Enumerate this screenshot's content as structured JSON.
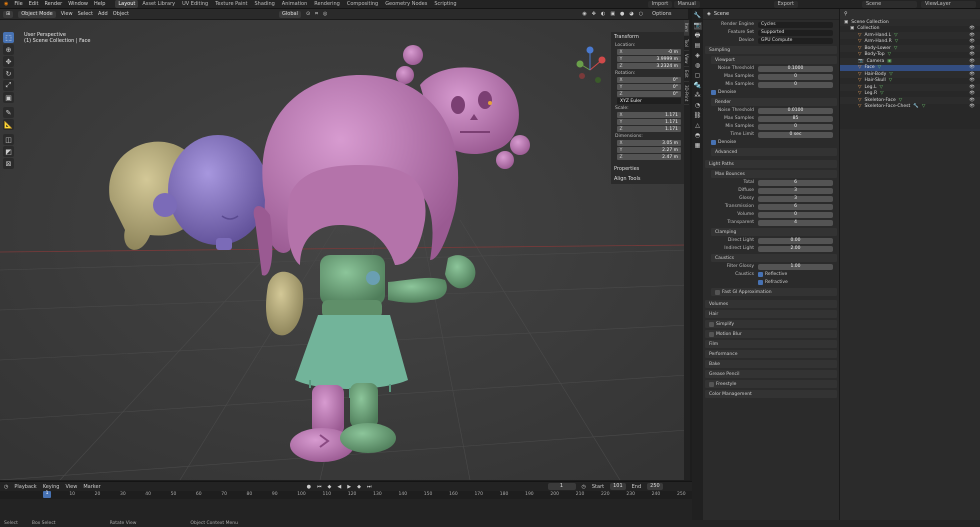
{
  "menu": [
    "File",
    "Edit",
    "Render",
    "Window",
    "Help"
  ],
  "workspaces": [
    "Layout",
    "Asset Library",
    "UV Editing",
    "Texture Paint",
    "Shading",
    "Animation",
    "Rendering",
    "Compositing",
    "Geometry Nodes",
    "Scripting"
  ],
  "top_right": {
    "export": "Export",
    "import": "Import",
    "manual": "Manual",
    "scene": "Scene",
    "view_layer": "ViewLayer"
  },
  "viewport_header": {
    "mode": "Object Mode",
    "view": "View",
    "select": "Select",
    "add": "Add",
    "object": "Object",
    "orientation": "Global",
    "options": "Options"
  },
  "viewport_info": {
    "line1": "User Perspective",
    "line2": "(1) Scene Collection | Face"
  },
  "transform": {
    "title": "Transform",
    "location_label": "Location:",
    "location": [
      "-0 m",
      "3.9999 m",
      "3.2324 m"
    ],
    "rotation_label": "Rotation:",
    "rotation": [
      "0°",
      "0°",
      "0°"
    ],
    "rotation_mode": "XYZ Euler",
    "scale_label": "Scale:",
    "scale": [
      "1.171",
      "1.171",
      "1.171"
    ],
    "dimensions_label": "Dimensions:",
    "dimensions": [
      "3.05 m",
      "2.27 m",
      "2.47 m"
    ],
    "axes": [
      "X",
      "Y",
      "Z"
    ],
    "properties": "Properties",
    "align_tools": "Align Tools"
  },
  "sidebar_tabs": [
    "Item",
    "Tool",
    "View",
    "Edit",
    "3D-Print"
  ],
  "props": {
    "scene": "Scene",
    "render_engine_label": "Render Engine",
    "render_engine": "Cycles",
    "feature_set_label": "Feature Set",
    "feature_set": "Supported",
    "device_label": "Device",
    "device": "GPU Compute",
    "sampling": "Sampling",
    "viewport": "Viewport",
    "vp_noise_label": "Noise Threshold",
    "vp_noise": "0.1000",
    "vp_max_label": "Max Samples",
    "vp_max": "0",
    "vp_min_label": "Min Samples",
    "vp_min": "0",
    "denoise": "Denoise",
    "render": "Render",
    "r_noise_label": "Noise Threshold",
    "r_noise": "0.0100",
    "r_max_label": "Max Samples",
    "r_max": "85",
    "r_min_label": "Min Samples",
    "r_min": "0",
    "time_limit_label": "Time Limit",
    "time_limit": "0 sec",
    "denoise2": "Denoise",
    "advanced": "Advanced",
    "light_paths": "Light Paths",
    "max_bounces": "Max Bounces",
    "total_label": "Total",
    "total": "6",
    "diffuse_label": "Diffuse",
    "diffuse": "3",
    "glossy_label": "Glossy",
    "glossy": "3",
    "transmission_label": "Transmission",
    "transmission": "6",
    "volume_label": "Volume",
    "volume": "0",
    "transparent_label": "Transparent",
    "transparent": "4",
    "clamping": "Clamping",
    "direct_label": "Direct Light",
    "direct": "0.00",
    "indirect_label": "Indirect Light",
    "indirect": "2.00",
    "caustics": "Caustics",
    "filter_glossy_label": "Filter Glossy",
    "filter_glossy": "1.00",
    "caustics_label": "Caustics",
    "reflective": "Reflective",
    "refractive": "Refractive",
    "fast_gi": "Fast GI Approximation",
    "sections": [
      "Volumes",
      "Hair",
      "Simplify",
      "Motion Blur",
      "Film",
      "Performance",
      "Bake",
      "Grease Pencil",
      "Freestyle",
      "Color Management"
    ]
  },
  "outliner": {
    "root": "Scene Collection",
    "collection": "Collection",
    "items": [
      "Arm-Hand.L",
      "Arm-Hand.R",
      "Body-Lower",
      "Body-Top",
      "Camera",
      "Face",
      "Hair-Body",
      "Hair-Skull",
      "Leg.L",
      "Leg.R",
      "Skeleton-Face",
      "Skeleton-Face-Chest"
    ]
  },
  "timeline": {
    "playback": "Playback",
    "keying": "Keying",
    "view": "View",
    "marker": "Marker",
    "current": "1",
    "start_label": "Start",
    "start": "101",
    "end_label": "End",
    "end": "250",
    "ticks": [
      "1",
      "10",
      "20",
      "30",
      "40",
      "50",
      "60",
      "70",
      "80",
      "90",
      "100",
      "110",
      "120",
      "130",
      "140",
      "150",
      "160",
      "170",
      "180",
      "190",
      "200",
      "210",
      "220",
      "230",
      "240",
      "250"
    ]
  },
  "status": {
    "select": "Select",
    "box_select": "Box Select",
    "rotate": "Rotate View",
    "context": "Object Context Menu"
  },
  "colors": {
    "accent": "#4772b3",
    "pink": "#c27ab7",
    "purple": "#8a76c6",
    "green": "#6fa07a",
    "yellow": "#b8ad7a"
  }
}
